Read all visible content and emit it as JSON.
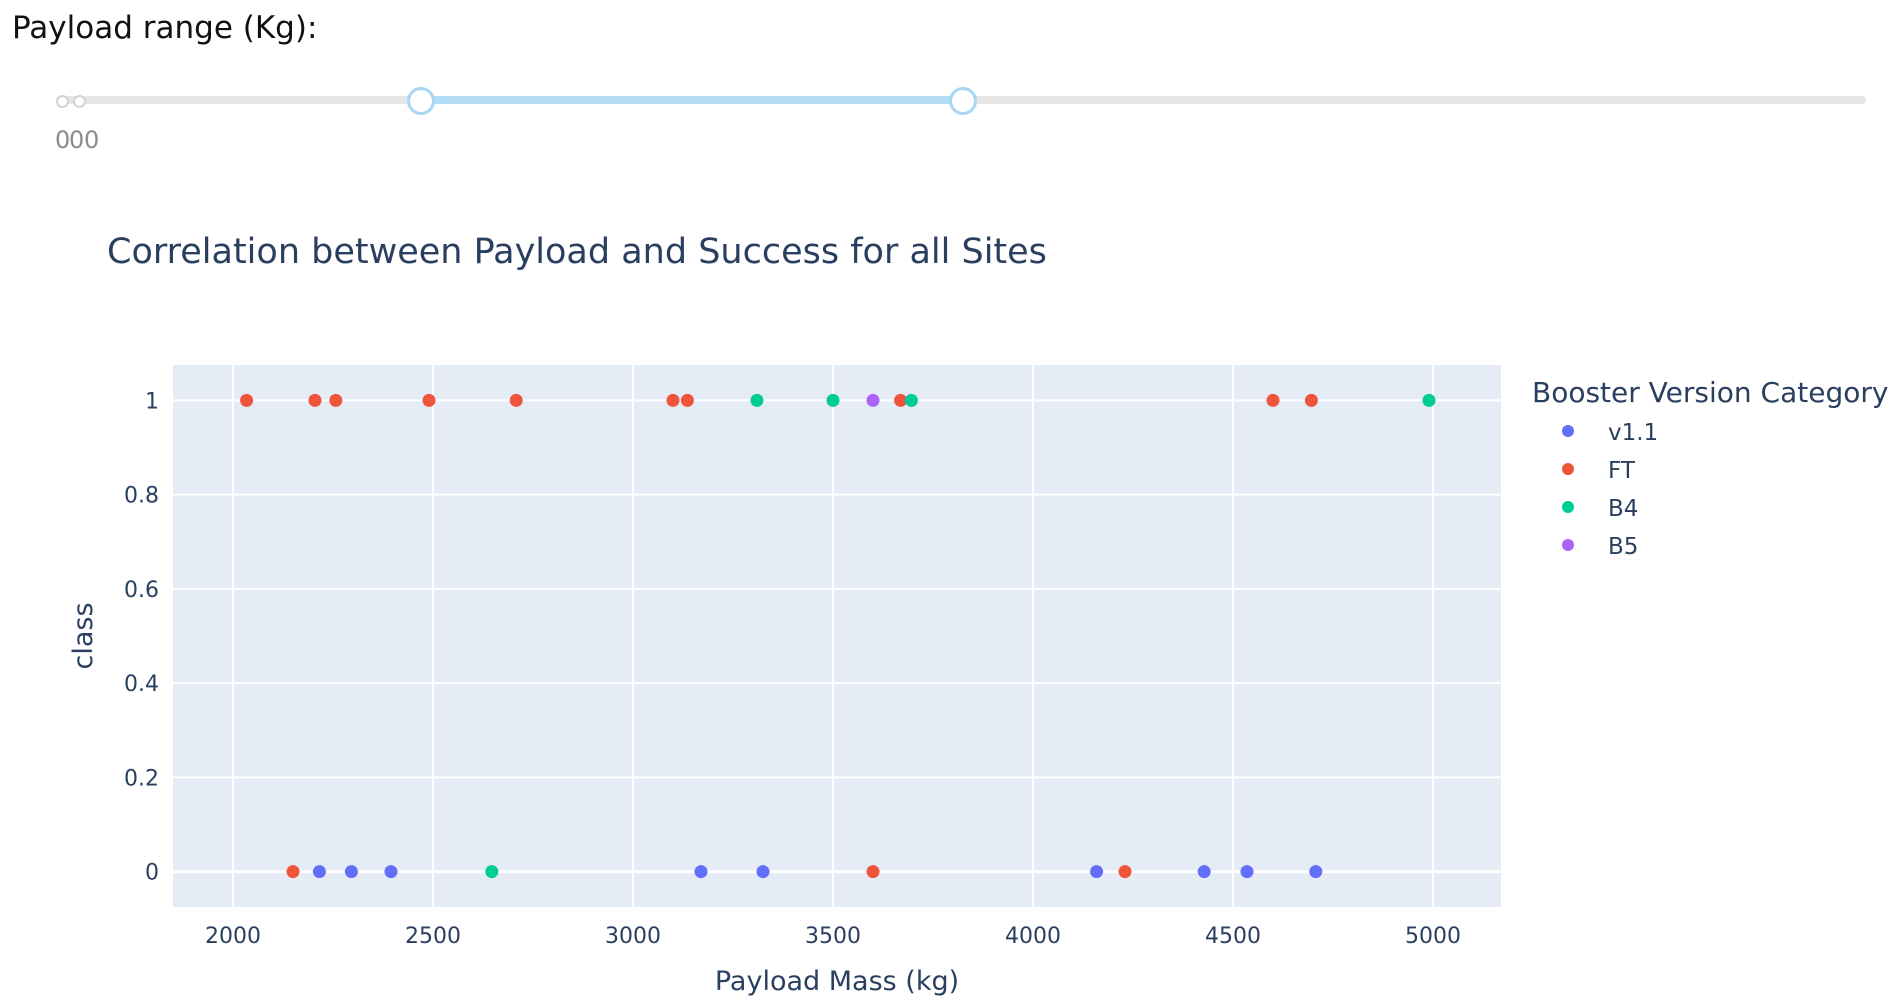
{
  "slider": {
    "label": "Payload range (Kg):",
    "mark_text": "0",
    "min": 0,
    "max": 10000,
    "selected_range": [
      2000,
      5000
    ],
    "colors": {
      "track": "#b5dcf5",
      "handle_border": "#a7d7f5",
      "rail": "#e6e6e6"
    }
  },
  "chart_data": {
    "type": "scatter",
    "title": "Correlation between Payload and Success for all Sites",
    "xlabel": "Payload Mass (kg)",
    "ylabel": "class",
    "xlim": [
      1850,
      5170
    ],
    "ylim": [
      -0.075,
      1.075
    ],
    "x_ticks": [
      2000,
      2500,
      3000,
      3500,
      4000,
      4500,
      5000
    ],
    "y_ticks": [
      0,
      0.2,
      0.4,
      0.6,
      0.8,
      1
    ],
    "y_tick_labels": [
      "0",
      "0.2",
      "0.4",
      "0.6",
      "0.8",
      "1"
    ],
    "grid": true,
    "legend": {
      "title": "Booster Version Category",
      "position": "right"
    },
    "series": [
      {
        "name": "v1.1",
        "color": "#636efa",
        "points": [
          [
            2216,
            0
          ],
          [
            2296,
            0
          ],
          [
            2395,
            0
          ],
          [
            3170,
            0
          ],
          [
            3325,
            0
          ],
          [
            4159,
            0
          ],
          [
            4428,
            0
          ],
          [
            4535,
            0
          ],
          [
            4707,
            0
          ]
        ]
      },
      {
        "name": "FT",
        "color": "#EF553B",
        "points": [
          [
            2034,
            1
          ],
          [
            2205,
            1
          ],
          [
            2257,
            1
          ],
          [
            2490,
            1
          ],
          [
            2708,
            1
          ],
          [
            3100,
            1
          ],
          [
            3136,
            1
          ],
          [
            3669,
            1
          ],
          [
            4600,
            1
          ],
          [
            4696,
            1
          ],
          [
            2150,
            0
          ],
          [
            3600,
            0
          ],
          [
            4230,
            0
          ]
        ]
      },
      {
        "name": "B4",
        "color": "#00cc96",
        "points": [
          [
            3310,
            1
          ],
          [
            3500,
            1
          ],
          [
            3696,
            1
          ],
          [
            4990,
            1
          ],
          [
            2647,
            0
          ]
        ]
      },
      {
        "name": "B5",
        "color": "#ab63fa",
        "points": [
          [
            3600,
            1
          ]
        ]
      }
    ]
  }
}
